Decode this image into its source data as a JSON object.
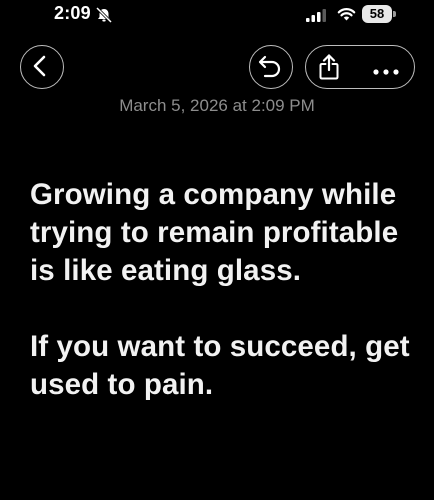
{
  "status_bar": {
    "time": "2:09",
    "battery_level": "58",
    "icons": [
      "bell-slash-icon",
      "cellular-signal-icon",
      "wifi-icon",
      "battery-icon"
    ]
  },
  "toolbar": {
    "back_icon": "chevron-left-icon",
    "undo_icon": "undo-icon",
    "share_icon": "share-icon",
    "more_icon": "ellipsis-icon",
    "button_border_color": "#bdbdbd"
  },
  "note": {
    "date": "March 5, 2026 at 2:09 PM",
    "paragraphs": [
      "Growing a company while trying to remain profitable is like eating glass.",
      "If you want to succeed, get used to pain."
    ]
  },
  "colors": {
    "background": "#000000",
    "text": "#f2f2f2",
    "secondary_text": "#8d8d8d"
  }
}
